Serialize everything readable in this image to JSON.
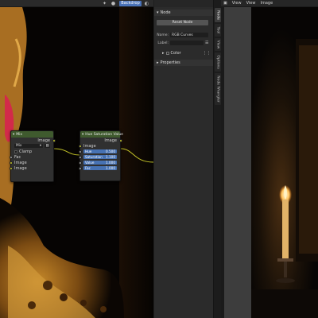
{
  "node_editor": {
    "header": {
      "backdrop_label": "Backdrop"
    },
    "mix_node": {
      "title": "Mix",
      "output_label": "Image",
      "blend_mode": "Mix",
      "clamp_label": "Clamp",
      "inputs": [
        "Fac",
        "Image",
        "Image"
      ]
    },
    "hsv_node": {
      "title": "Hue Saturation Value",
      "output_label": "Image",
      "input_image_label": "Image",
      "fields": [
        {
          "label": "Hue",
          "value": "0.500"
        },
        {
          "label": "Saturation",
          "value": "1.100"
        },
        {
          "label": "Value",
          "value": "1.000"
        },
        {
          "label": "Fac",
          "value": "1.000"
        }
      ]
    }
  },
  "sidebar": {
    "node_panel_title": "Node",
    "reset_node_label": "Reset Node",
    "name_label": "Name:",
    "name_value": "RGB Curves",
    "label_label": "Label:",
    "color_label": "Color",
    "properties_label": "Properties"
  },
  "tabs": [
    {
      "label": "Node",
      "active": true
    },
    {
      "label": "Tool",
      "active": false
    },
    {
      "label": "View",
      "active": false
    },
    {
      "label": "Options",
      "active": false
    },
    {
      "label": "Node Wrangler",
      "active": false
    }
  ],
  "image_editor": {
    "menus": [
      "View",
      "View",
      "Image"
    ]
  },
  "colors": {
    "accent_blue": "#4a72b8",
    "node_header_green": "#3f5a2e",
    "socket_yellow": "#c7c729",
    "socket_gray": "#a1a1a1"
  }
}
